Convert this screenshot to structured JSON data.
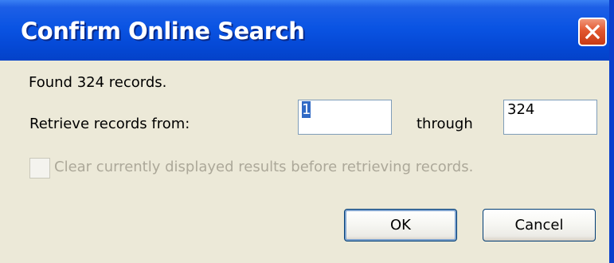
{
  "window": {
    "title": "Confirm Online Search",
    "close_icon": "close-icon"
  },
  "dialog": {
    "found_text": "Found 324 records.",
    "retrieve_label": "Retrieve records from:",
    "from_value": "1",
    "through_label": "through",
    "to_value": "324",
    "clear_checkbox_label": "Clear currently displayed results before retrieving records.",
    "clear_checkbox_checked": false,
    "clear_checkbox_enabled": false
  },
  "buttons": {
    "ok_label": "OK",
    "cancel_label": "Cancel"
  },
  "colors": {
    "titlebar": "#0A54E3",
    "dialog_background": "#ECE9D8",
    "close_button": "#E2572F",
    "selection": "#316AC5",
    "disabled_text": "#ACA899"
  }
}
